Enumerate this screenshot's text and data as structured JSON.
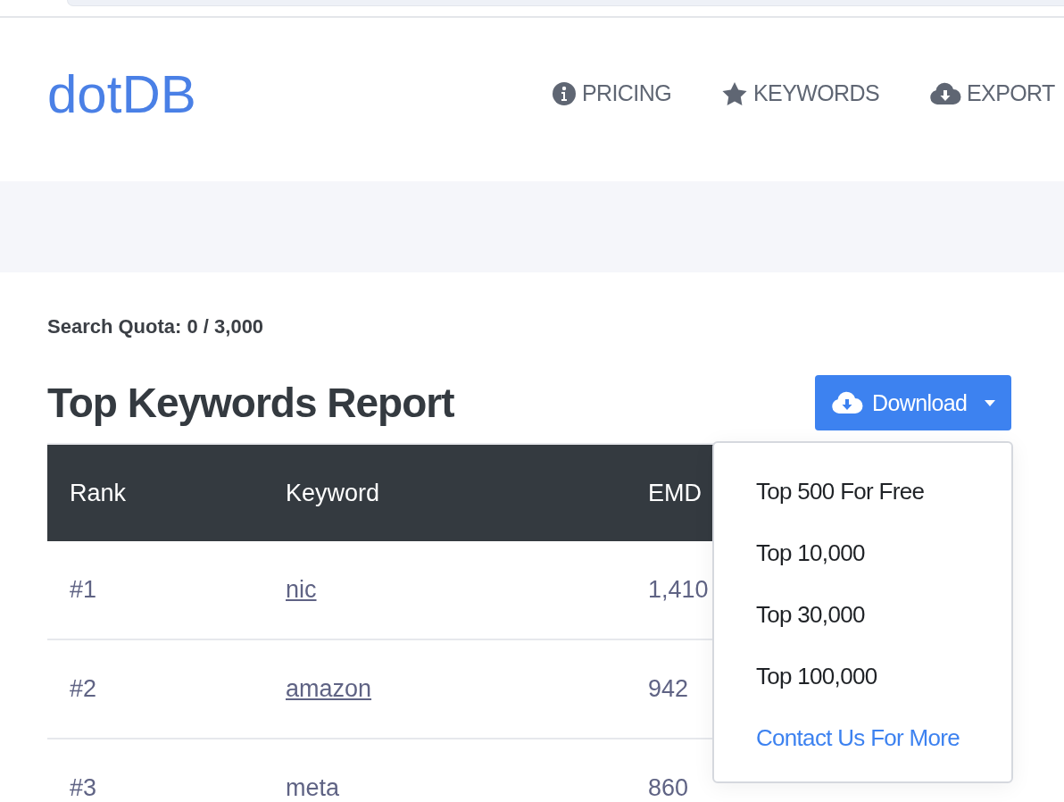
{
  "header": {
    "logo": "dotDB",
    "nav": [
      {
        "kind": "info",
        "label": "PRICING"
      },
      {
        "kind": "star",
        "label": "KEYWORDS"
      },
      {
        "kind": "cloud",
        "label": "EXPORT"
      }
    ]
  },
  "quota": "Search Quota: 0 / 3,000",
  "report": {
    "title": "Top Keywords Report",
    "download": {
      "label": "Download",
      "expanded": true,
      "menu": [
        {
          "kind": "item",
          "label": "Top 500 For Free"
        },
        {
          "kind": "item",
          "label": "Top 10,000"
        },
        {
          "kind": "item",
          "label": "Top 30,000"
        },
        {
          "kind": "item",
          "label": "Top 100,000"
        },
        {
          "kind": "link",
          "label": "Contact Us For More"
        }
      ]
    }
  },
  "table": {
    "columns": [
      "Rank",
      "Keyword",
      "EMD"
    ],
    "rows": [
      {
        "rank": "#1",
        "keyword": "nic",
        "linked": true,
        "emd": "1,410"
      },
      {
        "rank": "#2",
        "keyword": "amazon",
        "linked": true,
        "emd": "942"
      },
      {
        "rank": "#3",
        "keyword": "meta",
        "linked": false,
        "emd": "860"
      }
    ]
  }
}
